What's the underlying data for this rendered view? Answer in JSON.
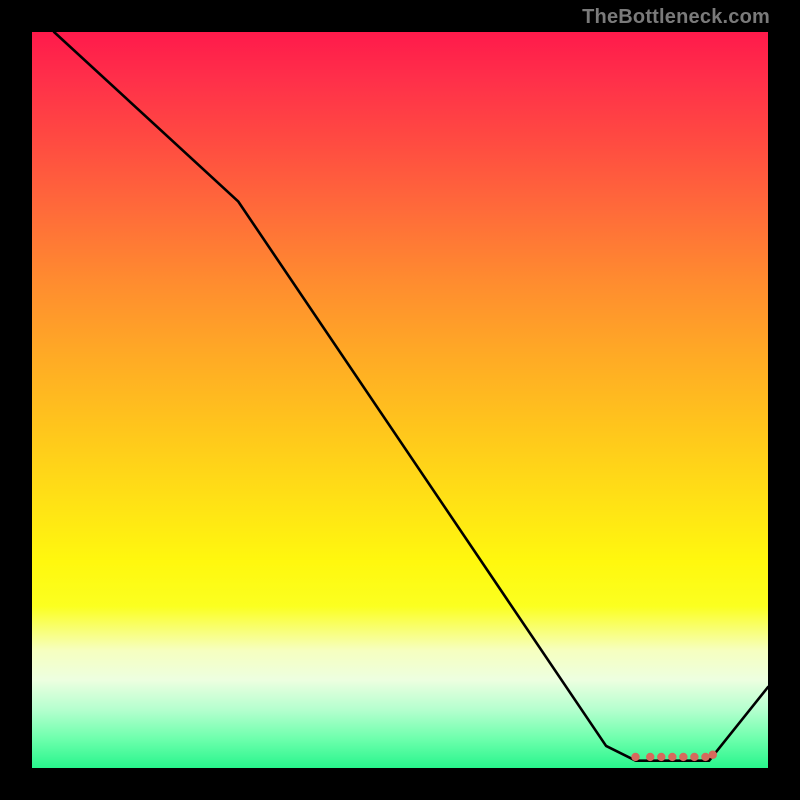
{
  "watermark": "TheBottleneck.com",
  "chart_data": {
    "type": "line",
    "title": "",
    "xlabel": "",
    "ylabel": "",
    "xlim": [
      0,
      100
    ],
    "ylim": [
      0,
      100
    ],
    "x": [
      0,
      3,
      28,
      78,
      82,
      85,
      87,
      89,
      91,
      92,
      100
    ],
    "values": [
      105,
      100,
      77,
      3,
      1,
      1,
      1,
      1,
      1,
      1,
      11
    ],
    "markers": {
      "x": [
        82,
        84,
        85.5,
        87,
        88.5,
        90,
        91.5,
        92.5
      ],
      "values": [
        1.5,
        1.5,
        1.5,
        1.5,
        1.5,
        1.5,
        1.5,
        1.8
      ],
      "color": "#d66a5c",
      "size": 4.2
    }
  }
}
